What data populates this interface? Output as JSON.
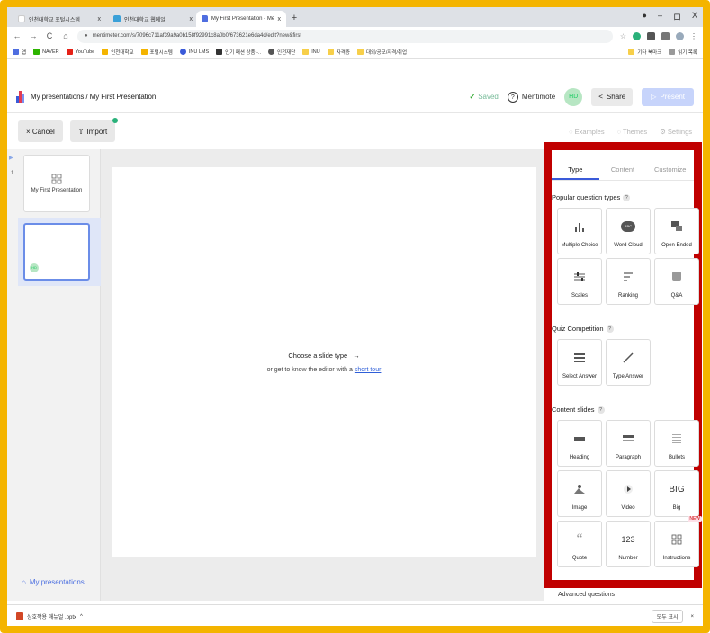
{
  "browser": {
    "tabs": [
      {
        "label": "인천대학교 포털시스템",
        "color": "#ffffff"
      },
      {
        "label": "인천대학교 웹메일",
        "color": "#3aa0d8"
      },
      {
        "label": "My First Presentation - Mentim",
        "color": "#4f6ee0"
      }
    ],
    "new_tab": "+",
    "window_controls": [
      "●",
      "–",
      "ロ",
      "X"
    ],
    "url": "mentimeter.com/s/7096c711af39a9a0b158f92991c8a0b0/673621e6da4d/edit?new&first",
    "bookmarks": [
      "앱",
      "NAVER",
      "YouTube",
      "인천대학교",
      "포털시스템",
      "INU LMS",
      "인기 패션 상품 -..",
      "인천재단",
      "INU",
      "자격증",
      "대외/공모/자격/취업"
    ],
    "bookmarks_right": [
      "기타 북마크",
      "읽기 목록"
    ]
  },
  "header": {
    "breadcrumb": "My presentations / My First Presentation",
    "saved": "Saved",
    "mentimote": "Mentimote",
    "avatar": "HD",
    "share": "Share",
    "present": "Present"
  },
  "toolbar": {
    "cancel": "× Cancel",
    "import": "Import",
    "examples": "Examples",
    "themes": "Themes",
    "settings": "Settings"
  },
  "slides": [
    {
      "num": "1",
      "title": "My First Presentation"
    },
    {
      "num": "",
      "title": "",
      "badge": "HD"
    }
  ],
  "my_presentations": "My presentations",
  "canvas": {
    "choose": "Choose a slide type",
    "tour_prefix": "or get to know the editor with a",
    "tour_link": "short tour"
  },
  "panel": {
    "tabs": [
      "Type",
      "Content",
      "Customize"
    ],
    "sections": {
      "popular": {
        "title": "Popular question types",
        "items": [
          "Multiple Choice",
          "Word Cloud",
          "Open Ended",
          "Scales",
          "Ranking",
          "Q&A"
        ]
      },
      "quiz": {
        "title": "Quiz Competition",
        "items": [
          "Select Answer",
          "Type Answer"
        ]
      },
      "content": {
        "title": "Content slides",
        "items": [
          "Heading",
          "Paragraph",
          "Bullets",
          "Image",
          "Video",
          "Big",
          "Quote",
          "Number",
          "Instructions"
        ]
      }
    },
    "icon_text": {
      "big": "BIG",
      "number": "123",
      "wordcloud": "ABC"
    },
    "new_badge": "NEW",
    "advanced": "Advanced questions"
  },
  "downloads": {
    "file": "상호작용 매뉴얼 .pptx",
    "show_all": "모두 표시"
  }
}
